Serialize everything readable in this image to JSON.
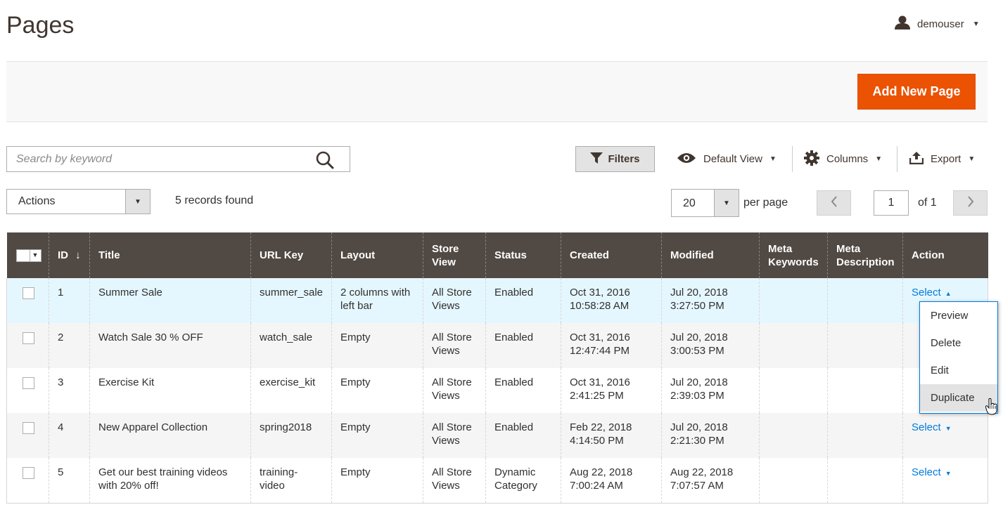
{
  "header": {
    "title": "Pages",
    "user": "demouser"
  },
  "toolbar": {
    "add_label": "Add New Page"
  },
  "search": {
    "placeholder": "Search by keyword"
  },
  "controls": {
    "filters": "Filters",
    "view": "Default View",
    "columns": "Columns",
    "export": "Export",
    "actions": "Actions",
    "records": "5 records found"
  },
  "pagination": {
    "per_page": "20",
    "per_page_label": "per page",
    "page": "1",
    "of": "of 1"
  },
  "table": {
    "headers": [
      "ID",
      "Title",
      "URL Key",
      "Layout",
      "Store View",
      "Status",
      "Created",
      "Modified",
      "Meta Keywords",
      "Meta Description",
      "Action"
    ],
    "sort_glyph": "↓",
    "select_label": "Select",
    "rows": [
      {
        "id": "1",
        "title": "Summer Sale",
        "url": "summer_sale",
        "layout": "2 columns with left bar",
        "store": "All Store Views",
        "status": "Enabled",
        "created": "Oct 31, 2016 10:58:28 AM",
        "modified": "Jul 20, 2018 3:27:50 PM"
      },
      {
        "id": "2",
        "title": "Watch Sale 30 % OFF",
        "url": "watch_sale",
        "layout": "Empty",
        "store": "All Store Views",
        "status": "Enabled",
        "created": "Oct 31, 2016 12:47:44 PM",
        "modified": "Jul 20, 2018 3:00:53 PM"
      },
      {
        "id": "3",
        "title": "Exercise Kit",
        "url": "exercise_kit",
        "layout": "Empty",
        "store": "All Store Views",
        "status": "Enabled",
        "created": "Oct 31, 2016 2:41:25 PM",
        "modified": "Jul 20, 2018 2:39:03 PM"
      },
      {
        "id": "4",
        "title": "New Apparel Collection",
        "url": "spring2018",
        "layout": "Empty",
        "store": "All Store Views",
        "status": "Enabled",
        "created": "Feb 22, 2018 4:14:50 PM",
        "modified": "Jul 20, 2018 2:21:30 PM"
      },
      {
        "id": "5",
        "title": "Get our best training videos with 20% off!",
        "url": "training-video",
        "layout": "Empty",
        "store": "All Store Views",
        "status": "Dynamic Category",
        "created": "Aug 22, 2018 7:00:24 AM",
        "modified": "Aug 22, 2018 7:07:57 AM"
      }
    ]
  },
  "action_menu": {
    "items": [
      "Preview",
      "Delete",
      "Edit",
      "Duplicate"
    ],
    "hovered": "Duplicate"
  },
  "colors": {
    "primary_button": "#eb5202",
    "table_header": "#514943",
    "link": "#007bdb",
    "highlight_row": "#e5f7fe"
  }
}
